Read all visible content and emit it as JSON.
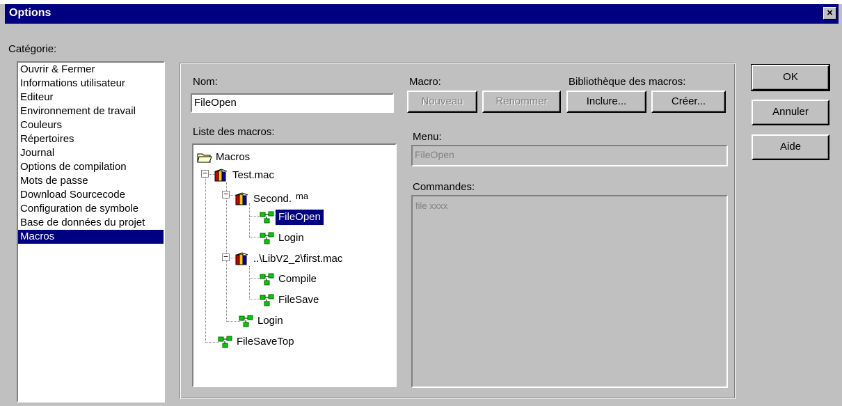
{
  "window": {
    "title": "Options",
    "close_glyph": "×"
  },
  "category": {
    "label": "Catégorie:",
    "items": [
      "Ouvrir & Fermer",
      "Informations utilisateur",
      "Editeur",
      "Environnement de travail",
      "Couleurs",
      "Répertoires",
      "Journal",
      "Options de compilation",
      "Mots de passe",
      "Download Sourcecode",
      "Configuration de symbole",
      "Base de données du projet",
      "Macros"
    ],
    "selected": "Macros"
  },
  "macros_panel": {
    "name_label": "Nom:",
    "name_value": "FileOpen",
    "macro_label": "Macro:",
    "new_button": "Nouveau",
    "rename_button": "Renommer",
    "library_label": "Bibliothèque des macros:",
    "include_button": "Inclure...",
    "create_button": "Créer...",
    "list_label": "Liste des macros:",
    "menu_label": "Menu:",
    "menu_value": "FileOpen",
    "commands_label": "Commandes:",
    "commands_value": "file xxxx",
    "tree": {
      "root": "Macros",
      "test_mac": "Test.mac",
      "second": "Second.",
      "second_suffix": "ma",
      "fileopen": "FileOpen",
      "login1": "Login",
      "first_mac": "..\\LibV2_2\\first.mac",
      "compile": "Compile",
      "filesave": "FileSave",
      "login2": "Login",
      "filesavetop": "FileSaveTop"
    }
  },
  "buttons": {
    "ok": "OK",
    "cancel": "Annuler",
    "help": "Aide"
  },
  "colors": {
    "selection": "#000080",
    "face": "#c0c0c0"
  }
}
